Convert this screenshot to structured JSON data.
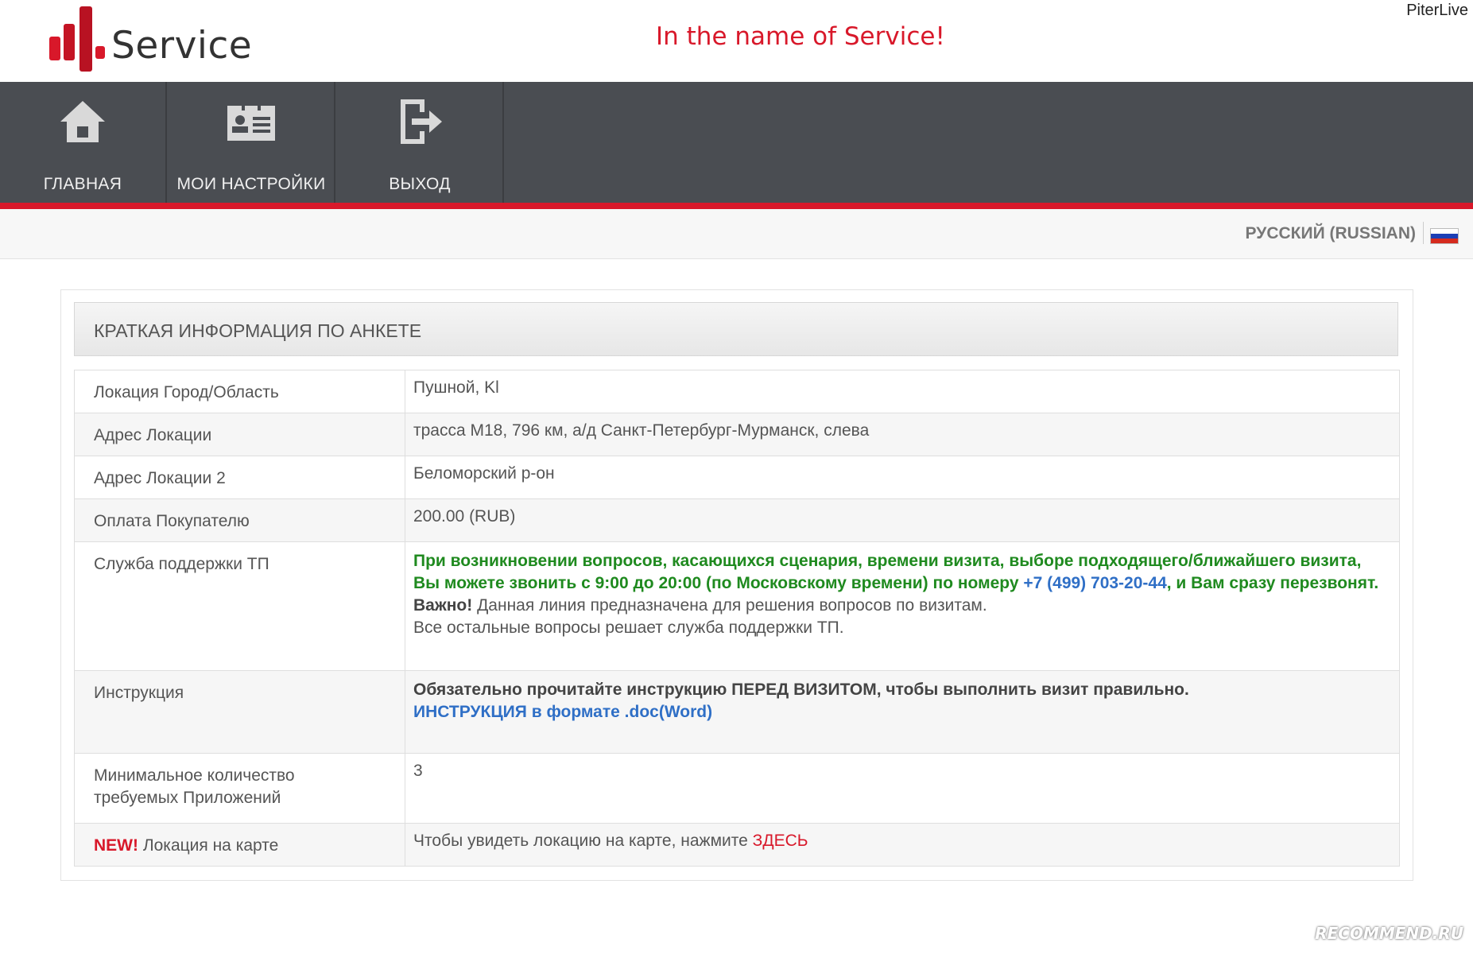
{
  "header": {
    "logo_text": "Service",
    "slogan_red": "In the name of ",
    "slogan_dark": "Service!",
    "corner_label": "PiterLive"
  },
  "nav": {
    "items": [
      {
        "label": "ГЛАВНАЯ",
        "icon": "home-icon"
      },
      {
        "label": "МОИ НАСТРОЙКИ",
        "icon": "profile-card-icon"
      },
      {
        "label": "ВЫХОД",
        "icon": "logout-icon"
      }
    ]
  },
  "language": {
    "label": "РУССКИЙ (RUSSIAN)",
    "flag_colors": [
      "#ffffff",
      "#1c3fb5",
      "#d52b1e"
    ]
  },
  "panel": {
    "title": "КРАТКАЯ ИНФОРМАЦИЯ ПО АНКЕТЕ",
    "rows": [
      {
        "key": "Локация Город/Область",
        "value": "Пушной, Kl"
      },
      {
        "key": "Адрес Локации",
        "value": "трасса М18, 796 км, а/д Санкт-Петербург-Мурманск, слева"
      },
      {
        "key": "Адрес Локации 2",
        "value": "Беломорский р-он"
      },
      {
        "key": "Оплата Покупателю",
        "value": "200.00 (RUB)"
      }
    ],
    "support": {
      "key": "Служба поддержки ТП",
      "green_text_1": "При возникновении вопросов, касающихся сценария, времени визита, выборе подходящего/ближайшего визита, Вы можете звонить с 9:00 до 20:00 (по Московскому времени) по номеру ",
      "phone": "+7 (499) 703-20-44",
      "green_text_2": ", и Вам сразу перезвонят.",
      "important_label": "Важно!",
      "important_text": " Данная линия предназначена для решения вопросов по визитам.",
      "other_text": "Все остальные вопросы решает служба поддержки ТП."
    },
    "instruction": {
      "key": "Инструкция",
      "bold_text": "Обязательно прочитайте инструкцию ПЕРЕД ВИЗИТОМ, чтобы выполнить визит правильно.",
      "link_text": "ИНСТРУКЦИЯ в формате .doc(Word)"
    },
    "min_apps": {
      "key_line1": "Минимальное количество",
      "key_line2": "требуемых Приложений",
      "value": "3"
    },
    "map": {
      "new_tag": "NEW!",
      "key": " Локация на карте",
      "text": "Чтобы увидеть локацию на карте, нажмите ",
      "link": "ЗДЕСЬ"
    }
  },
  "watermark": "RECOMMEND.RU",
  "colors": {
    "accent": "#d8182a",
    "nav_bg": "#4a4d52",
    "link": "#2f6fc6",
    "green": "#1f8a1f"
  }
}
